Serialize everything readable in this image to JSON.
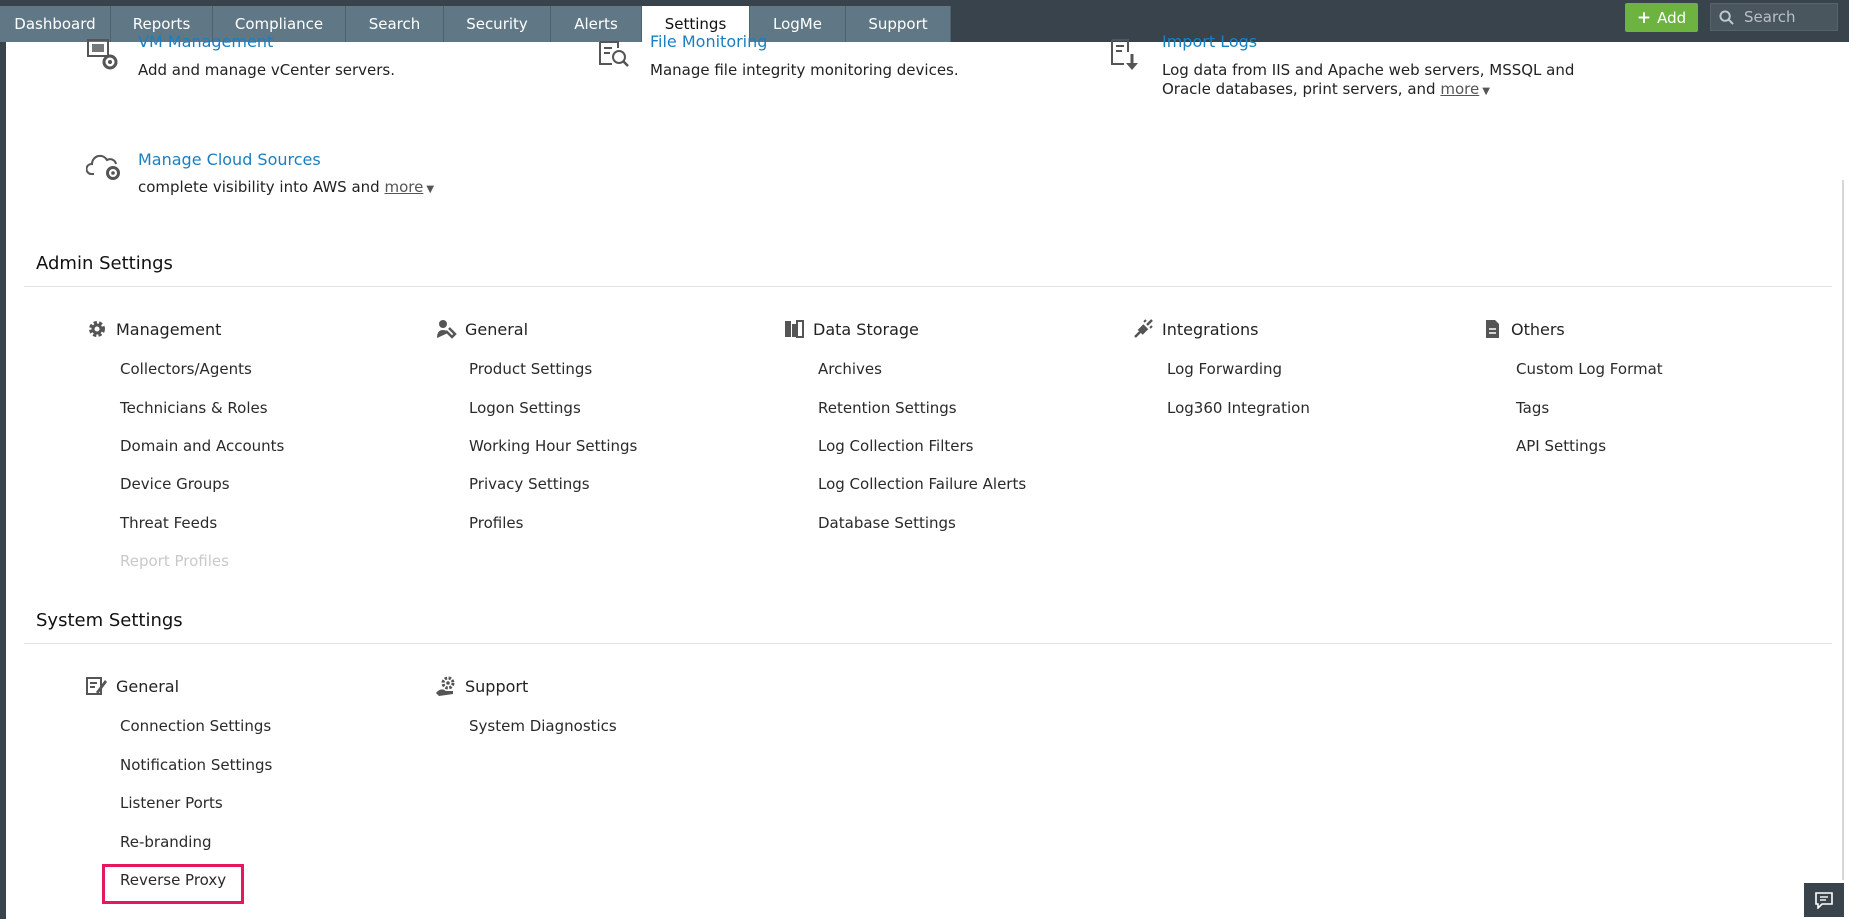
{
  "nav": {
    "tabs": [
      "Dashboard",
      "Reports",
      "Compliance",
      "Search",
      "Security",
      "Alerts",
      "Settings",
      "LogMe",
      "Support"
    ],
    "active_tab": "Settings",
    "add_label": "Add",
    "search_placeholder": "Search"
  },
  "log_sources": [
    {
      "title": "VM Management",
      "desc": "Add and manage vCenter servers.",
      "icon": "vm-gear-icon"
    },
    {
      "title": "File Monitoring",
      "desc": "Manage file integrity monitoring devices.",
      "icon": "file-search-icon"
    },
    {
      "title": "Import Logs",
      "desc_line1": "Log data from IIS and Apache web servers, MSSQL and",
      "desc_line2": "Oracle databases, print servers, and",
      "more": "more",
      "icon": "import-file-icon"
    },
    {
      "title": "Manage Cloud Sources",
      "desc": "complete visibility into AWS and",
      "more": "more",
      "icon": "cloud-gear-icon"
    }
  ],
  "admin_settings": {
    "title": "Admin Settings",
    "categories": [
      {
        "heading": "Management",
        "icon": "gear-icon",
        "links": [
          "Collectors/Agents",
          "Technicians & Roles",
          "Domain and Accounts",
          "Device Groups",
          "Threat Feeds",
          "Report Profiles"
        ]
      },
      {
        "heading": "General",
        "icon": "wrench-user-icon",
        "links": [
          "Product Settings",
          "Logon Settings",
          "Working Hour Settings",
          "Privacy Settings",
          "Profiles"
        ]
      },
      {
        "heading": "Data Storage",
        "icon": "storage-icon",
        "links": [
          "Archives",
          "Retention Settings",
          "Log Collection Filters",
          "Log Collection Failure Alerts",
          "Database Settings"
        ]
      },
      {
        "heading": "Integrations",
        "icon": "plug-icon",
        "links": [
          "Log Forwarding",
          "Log360 Integration"
        ]
      },
      {
        "heading": "Others",
        "icon": "document-icon",
        "links": [
          "Custom Log Format",
          "Tags",
          "API Settings"
        ]
      }
    ]
  },
  "system_settings": {
    "title": "System Settings",
    "categories": [
      {
        "heading": "General",
        "icon": "edit-settings-icon",
        "links": [
          "Connection Settings",
          "Notification Settings",
          "Listener Ports",
          "Re-branding",
          "Reverse Proxy"
        ]
      },
      {
        "heading": "Support",
        "icon": "support-gear-icon",
        "links": [
          "System Diagnostics"
        ]
      }
    ]
  },
  "colors": {
    "topbar": "#39434b",
    "tab": "#607886",
    "link_blue": "#1a7fc1",
    "add_green": "#6cb33f",
    "highlight": "#e5175e"
  }
}
